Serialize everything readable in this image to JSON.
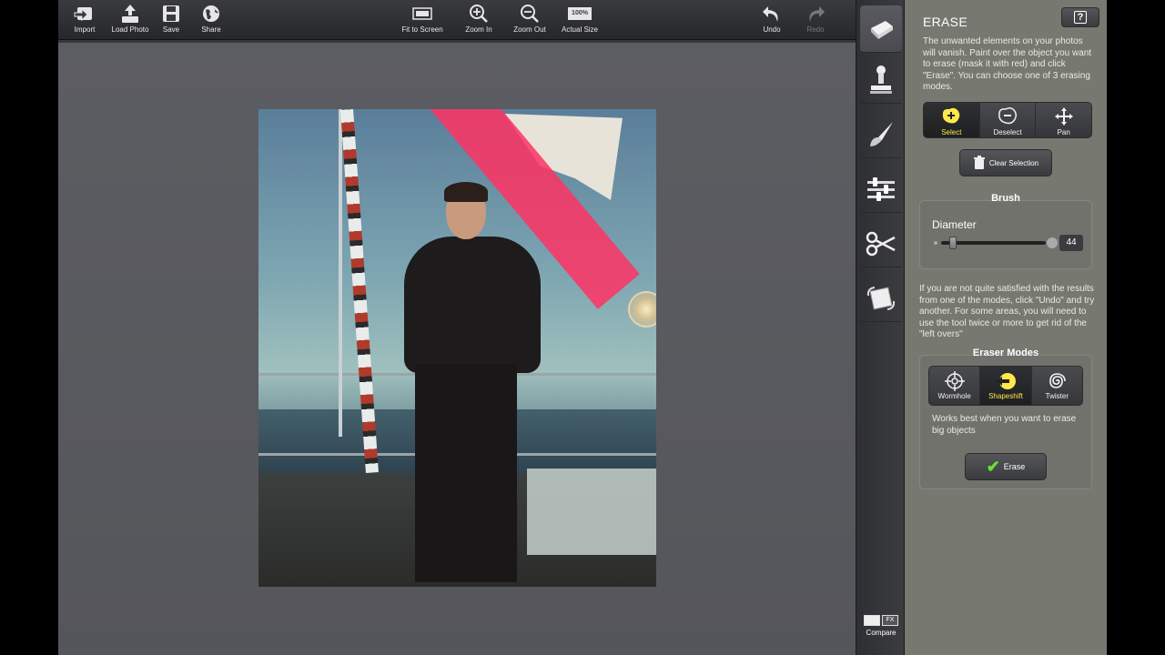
{
  "toolbar": {
    "import": "Import",
    "load_photo": "Load Photo",
    "save": "Save",
    "share": "Share",
    "fit_to_screen": "Fit to Screen",
    "zoom_in": "Zoom In",
    "zoom_out": "Zoom Out",
    "actual_size": "Actual Size",
    "actual_size_badge": "100%",
    "undo": "Undo",
    "redo": "Redo"
  },
  "tools": {
    "items": [
      {
        "name": "eraser",
        "glyph": "▭",
        "active": true
      },
      {
        "name": "stamp",
        "glyph": "♙",
        "active": false
      },
      {
        "name": "brush",
        "glyph": "✎",
        "active": false
      },
      {
        "name": "adjust",
        "glyph": "☰",
        "active": false
      },
      {
        "name": "scissors",
        "glyph": "✂",
        "active": false
      },
      {
        "name": "crop-rotate",
        "glyph": "◇",
        "active": false
      }
    ],
    "compare_label": "Compare",
    "compare_fx": "FX"
  },
  "panel": {
    "title": "ERASE",
    "help_label": "?",
    "description": "The unwanted elements on your photos will vanish. Paint over the object you want to erase (mask it with red) and click \"Erase\". You can choose one of 3 erasing modes.",
    "select_modes": [
      {
        "label": "Select",
        "icon": "plus-blob-icon",
        "active": true
      },
      {
        "label": "Deselect",
        "icon": "minus-blob-icon",
        "active": false
      },
      {
        "label": "Pan",
        "icon": "move-arrows-icon",
        "active": false
      }
    ],
    "clear_selection": "Clear Selection",
    "brush_title": "Brush",
    "diameter_label": "Diameter",
    "diameter_value": "44",
    "tip": "If you are not quite satisfied with the results from one of the modes, click \"Undo\" and try another. For some areas, you will need to use the tool twice or more to get rid of the \"left overs\"",
    "eraser_modes_title": "Eraser Modes",
    "eraser_modes": [
      {
        "label": "Wormhole",
        "icon": "crosshair-icon",
        "active": false
      },
      {
        "label": "Shapeshift",
        "icon": "shapeshift-icon",
        "active": true
      },
      {
        "label": "Twister",
        "icon": "spiral-icon",
        "active": false
      }
    ],
    "mode_description": "Works best when you want to erase big objects",
    "erase_button": "Erase"
  },
  "colors": {
    "accent_yellow": "#ffe84a",
    "mask_red": "#ff3264",
    "panel_bg": "#777870",
    "check_green": "#67e23c"
  }
}
